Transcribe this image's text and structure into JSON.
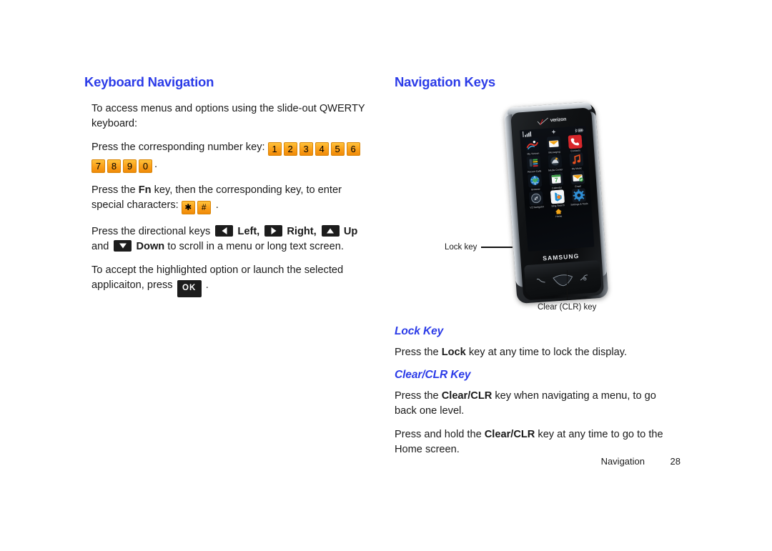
{
  "document": {
    "footer_section": "Navigation",
    "page_number": "28",
    "accent_color": "#2B3BE8",
    "key_color": "#FBA21B"
  },
  "left_column": {
    "heading": "Keyboard Navigation",
    "intro": "To access menus and options using the slide-out QWERTY keyboard:",
    "number_key_lead": "Press the corresponding number key:",
    "number_keys": [
      "1",
      "2",
      "3",
      "4",
      "5",
      "6",
      "7",
      "8",
      "9",
      "0"
    ],
    "number_key_trailing": ".",
    "fn_sentence_part1": "Press the",
    "fn_label": "Fn",
    "fn_sentence_part2": "key, then the corresponding key, to enter special characters:",
    "symbol_keys": [
      "✱",
      "#"
    ],
    "symbol_trailing": ".",
    "directional_lead": "Press the directional keys",
    "dir_left_label": "Left,",
    "dir_right_label": "Right,",
    "dir_up_label": "Up",
    "dir_and": "and",
    "dir_down_label": "Down",
    "directional_tail": "to scroll in a menu or long text screen.",
    "accept_lead": "To accept the highlighted option or launch the selected applicaiton, press",
    "ok_label": "OK",
    "accept_trailing": "."
  },
  "right_column": {
    "heading": "Navigation Keys",
    "lock_key": {
      "heading": "Lock Key",
      "text_part1": "Press the",
      "bold": "Lock",
      "text_part2": "key at any time to lock the display."
    },
    "clear_key": {
      "heading": "Clear/CLR Key",
      "p1_part1": "Press the",
      "p1_bold": "Clear/CLR",
      "p1_part2": "key when navigating a menu, to go back one level.",
      "p2_part1": "Press and hold the",
      "p2_bold": "Clear/CLR",
      "p2_part2": "key at any time to go to the Home screen."
    }
  },
  "phone_figure": {
    "brand_carrier": "verizon",
    "brand_maker": "SAMSUNG",
    "callout_lock": "Lock key",
    "callout_clear": "Clear (CLR) key",
    "home_label": "Home",
    "apps": [
      {
        "label": "My Verizon"
      },
      {
        "label": "Messaging"
      },
      {
        "label": "Contacts"
      },
      {
        "label": "Recent Calls"
      },
      {
        "label": "Media Center"
      },
      {
        "label": "My Music"
      },
      {
        "label": "Browser"
      },
      {
        "label": "Calendar"
      },
      {
        "label": "Email"
      },
      {
        "label": "VZ Navigator"
      },
      {
        "label": "Bing Search"
      },
      {
        "label": "Settings & Tools"
      }
    ]
  }
}
